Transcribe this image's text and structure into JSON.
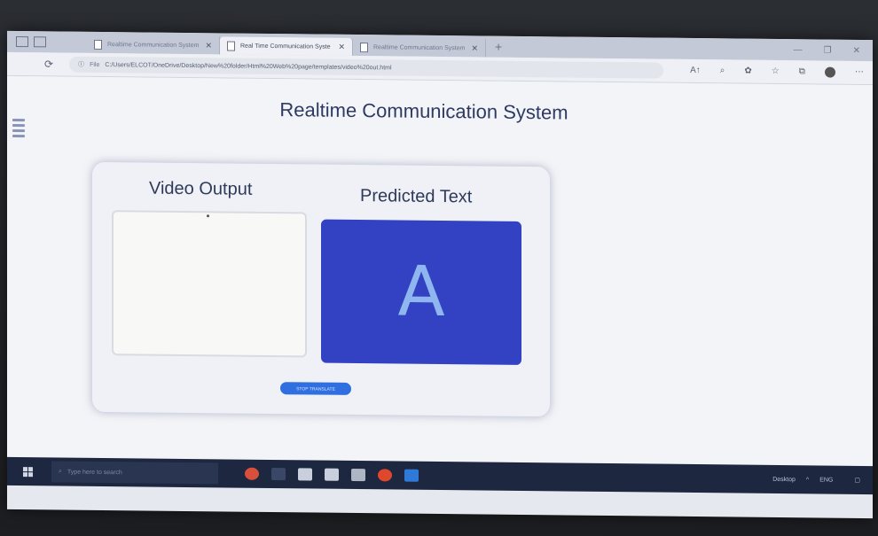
{
  "browser": {
    "tabs": [
      {
        "label": "Realtime Communication System",
        "active": false
      },
      {
        "label": "Real Time Communication Syste",
        "active": true
      },
      {
        "label": "Realtime Communication System",
        "active": false
      }
    ],
    "url_scheme": "File",
    "url": "C:/Users/ELCOT/OneDrive/Desktop/New%20folder/Html%20Web%20page/templates/video%20out.html"
  },
  "page": {
    "title": "Realtime Communication System",
    "video_title": "Video Output",
    "predicted_title": "Predicted Text",
    "predicted_letter": "A",
    "stop_button": "STOP TRANSLATE"
  },
  "taskbar": {
    "search_placeholder": "Type here to search",
    "desktop_label": "Desktop",
    "lang": "ENG"
  },
  "colors": {
    "accent": "#3242c2",
    "button": "#2f6fe0",
    "title": "#2e3a63"
  }
}
